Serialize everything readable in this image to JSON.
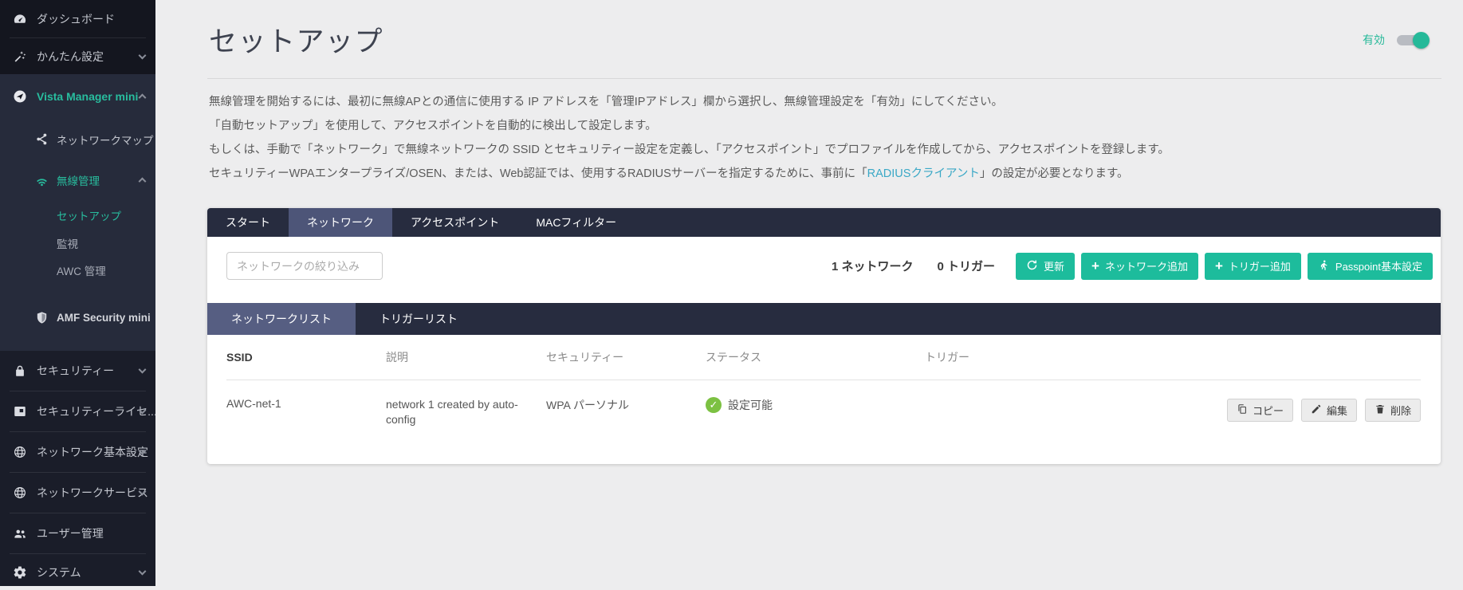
{
  "colors": {
    "accent_teal": "#1dbc9c",
    "sidebar_active_teal": "#28bd9e",
    "link_blue": "#3aa8c6",
    "status_green": "#7cc142",
    "tabbar_dark": "#272c3f",
    "tab_active": "#4d5578"
  },
  "icons": {
    "plus": "+",
    "check": "✓"
  },
  "sidebar": {
    "items": [
      {
        "label": "ダッシュボード"
      },
      {
        "label": "かんたん設定"
      },
      {
        "label": "Vista Manager mini"
      },
      {
        "label": "ネットワークマップ"
      },
      {
        "label": "無線管理"
      },
      {
        "label": "セットアップ"
      },
      {
        "label": "監視"
      },
      {
        "label": "AWC 管理"
      },
      {
        "label": "AMF Security mini"
      },
      {
        "label": "セキュリティー"
      },
      {
        "label": "セキュリティーライセ..."
      },
      {
        "label": "ネットワーク基本設定"
      },
      {
        "label": "ネットワークサービス"
      },
      {
        "label": "ユーザー管理"
      },
      {
        "label": "システム"
      }
    ]
  },
  "header": {
    "title": "セットアップ",
    "enabled_label": "有効"
  },
  "intro": {
    "line1": "無線管理を開始するには、最初に無線APとの通信に使用する IP アドレスを「管理IPアドレス」欄から選択し、無線管理設定を「有効」にしてください。",
    "line2": "「自動セットアップ」を使用して、アクセスポイントを自動的に検出して設定します。",
    "line3": "もしくは、手動で「ネットワーク」で無線ネットワークの SSID とセキュリティー設定を定義し、「アクセスポイント」でプロファイルを作成してから、アクセスポイントを登録します。",
    "line4_before": "セキュリティーWPAエンタープライズ/OSEN、または、Web認証では、使用するRADIUSサーバーを指定するために、事前に「",
    "line4_link": "RADIUSクライアント",
    "line4_after": "」の設定が必要となります。"
  },
  "tabs": [
    {
      "label": "スタート"
    },
    {
      "label": "ネットワーク"
    },
    {
      "label": "アクセスポイント"
    },
    {
      "label": "MACフィルター"
    }
  ],
  "toolbar": {
    "filter_placeholder": "ネットワークの絞り込み",
    "network_count": "1 ネットワーク",
    "trigger_count": "0 トリガー",
    "refresh_label": "更新",
    "add_network_label": "ネットワーク追加",
    "add_trigger_label": "トリガー追加",
    "passpoint_label": "Passpoint基本設定"
  },
  "subtabs": [
    {
      "label": "ネットワークリスト"
    },
    {
      "label": "トリガーリスト"
    }
  ],
  "table": {
    "headers": {
      "ssid": "SSID",
      "description": "説明",
      "security": "セキュリティー",
      "status": "ステータス",
      "trigger": "トリガー"
    },
    "row": {
      "ssid": "AWC-net-1",
      "description": "network 1 created by auto-config",
      "security": "WPA パーソナル",
      "status": "設定可能",
      "trigger": ""
    },
    "actions": {
      "copy": "コピー",
      "edit": "編集",
      "delete": "削除"
    }
  }
}
